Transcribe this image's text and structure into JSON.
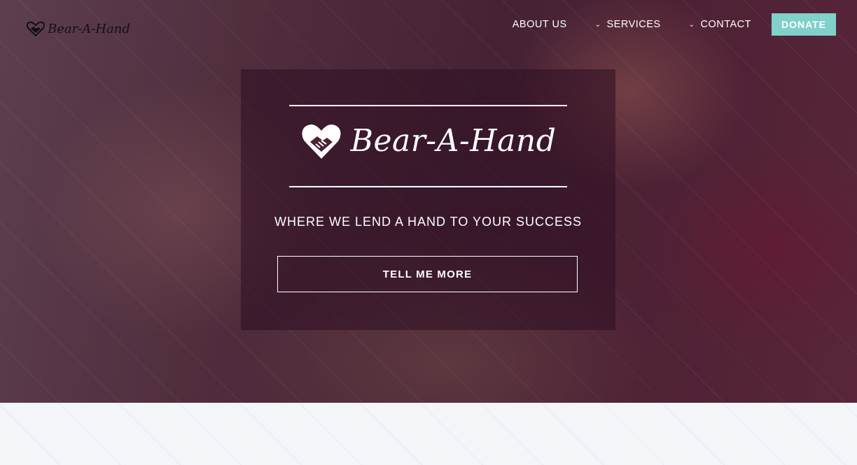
{
  "header": {
    "logo_text": "Bear-A-Hand",
    "nav": [
      {
        "label": "ABOUT US"
      },
      {
        "label": "SERVICES"
      },
      {
        "label": "CONTACT"
      }
    ],
    "donate_label": "DONATE"
  },
  "hero": {
    "brand_text": "Bear-A-Hand",
    "tagline": "WHERE WE LEND A HAND TO YOUR SUCCESS",
    "cta_label": "TELL ME MORE"
  },
  "colors": {
    "accent": "#7fd1c9",
    "panel": "#2d0f23",
    "background": "#f3f5f9"
  },
  "icons": {
    "logo": "heart-handshake-icon",
    "chevron": "chevron-down-icon"
  }
}
